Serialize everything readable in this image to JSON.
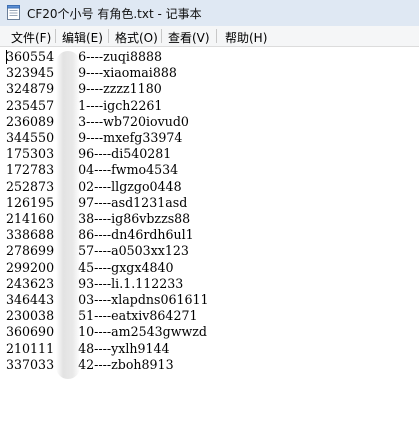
{
  "window": {
    "title": "CF20个小号 有角色.txt - 记事本"
  },
  "menu": {
    "file": "文件(F)",
    "edit": "编辑(E)",
    "format": "格式(O)",
    "view": "查看(V)",
    "help": "帮助(H)"
  },
  "lines": [
    "360554      6----zuqi8888",
    "323945      9----xiaomai888",
    "324879      9----zzzz1180",
    "235457      1----igch2261",
    "236089      3----wb720iovud0",
    "344550      9----mxefg33974",
    "175303      96----di540281",
    "172783      04----fwmo4534",
    "252873      02----llgzgo0448",
    "126195      97----asd1231asd",
    "214160      38----ig86vbzzs88",
    "338688      86----dn46rdh6ul1",
    "278699      57----a0503xx123",
    "299200      45----gxgx4840",
    "243623      93----li.1.112233",
    "346443      03----xlapdns061611",
    "230038      51----eatxiv864271",
    "360690      10----am2543gwwzd",
    "210111      48----yxlh9144",
    "337033      42----zboh8913"
  ]
}
